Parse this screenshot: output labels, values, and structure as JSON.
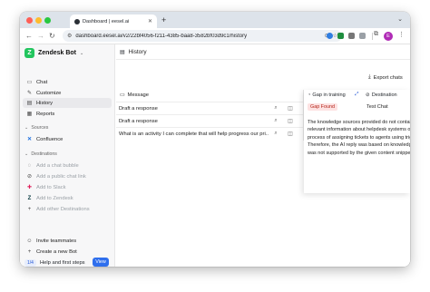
{
  "browser": {
    "tab_title": "Dashboard | eesel.ai",
    "url": "dashboard.eesel.ai/v2/22bf4056-f211-4385-baa8-3582bf03d9c1/history",
    "avatar_initial": "E"
  },
  "sidebar": {
    "bot_name": "Zendesk Bot",
    "bot_logo": "Z",
    "nav": [
      {
        "label": "Chat",
        "icon": "chat-icon"
      },
      {
        "label": "Customize",
        "icon": "customize-icon"
      },
      {
        "label": "History",
        "icon": "history-icon",
        "active": true
      },
      {
        "label": "Reports",
        "icon": "reports-icon"
      }
    ],
    "sources_label": "Sources",
    "sources": [
      {
        "label": "Confluence",
        "icon": "confluence-icon"
      }
    ],
    "destinations_label": "Destinations",
    "destinations": [
      {
        "label": "Add a chat bubble",
        "icon": "chat-bubble-icon"
      },
      {
        "label": "Add a public chat link",
        "icon": "link-icon"
      },
      {
        "label": "Add to Slack",
        "icon": "slack-icon"
      },
      {
        "label": "Add to Zendesk",
        "icon": "zendesk-icon"
      },
      {
        "label": "Add other Destinations",
        "icon": "plus-icon"
      }
    ],
    "bottom": [
      {
        "label": "Invite teammates",
        "icon": "invite-icon"
      },
      {
        "label": "Create a new Bot",
        "icon": "create-bot-icon"
      }
    ],
    "help_badge": "1/4",
    "help_label": "Help and first steps",
    "view_label": "View"
  },
  "main": {
    "title": "History",
    "export_label": "Export chats",
    "columns": {
      "message": "Message",
      "gap": "Gap in training",
      "destination": "Destination"
    },
    "rows": [
      {
        "message": "Draft a response"
      },
      {
        "message": "Draft a response"
      },
      {
        "message": "What is an activity I can complete that will help progress our pri..."
      }
    ],
    "detail": {
      "gap_badge": "Gap Found",
      "destination": "Test Chat",
      "explanation_lines": [
        "The knowledge sources provided do not contain",
        "relevant information about helpdesk systems or t",
        "process of assigning tickets to agents using trigg",
        "Therefore, the AI reply was based on knowledge",
        "was not supported by the given content snippets"
      ]
    }
  }
}
